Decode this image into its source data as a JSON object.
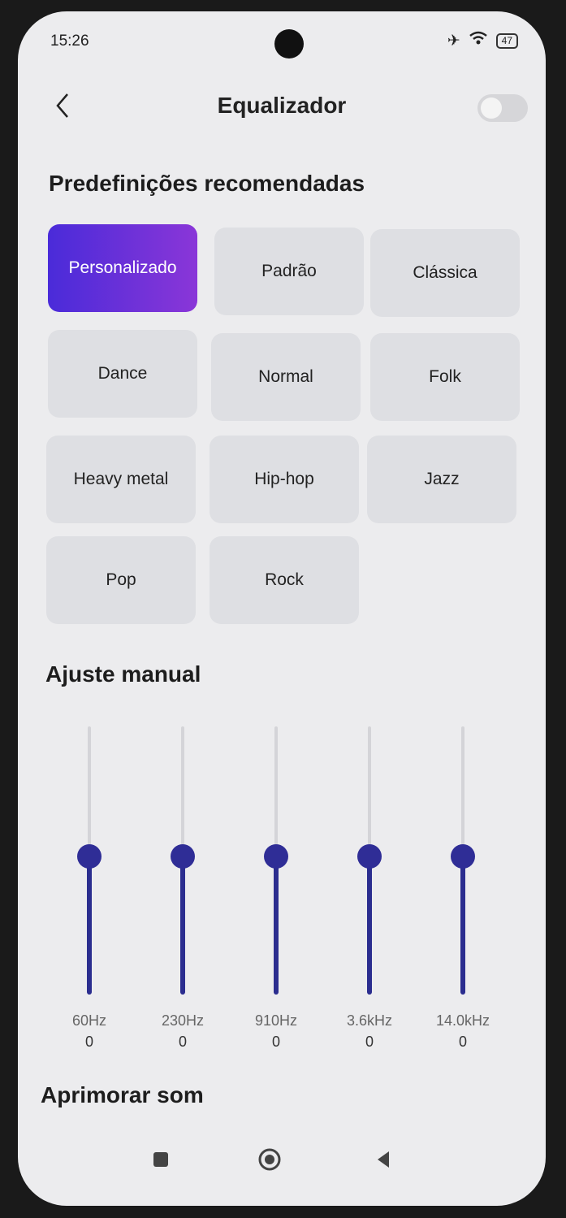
{
  "status_bar": {
    "time": "15:26",
    "battery": "47"
  },
  "header": {
    "title": "Equalizador",
    "toggle_on": false
  },
  "presets_section": {
    "title": "Predefinições recomendadas"
  },
  "presets": [
    {
      "label": "Personalizado",
      "active": true
    },
    {
      "label": "Padrão"
    },
    {
      "label": "Clássica"
    },
    {
      "label": "Dance"
    },
    {
      "label": "Normal"
    },
    {
      "label": "Folk"
    },
    {
      "label": "Heavy metal"
    },
    {
      "label": "Hip-hop"
    },
    {
      "label": "Jazz"
    },
    {
      "label": "Pop"
    },
    {
      "label": "Rock"
    }
  ],
  "manual_section": {
    "title": "Ajuste manual"
  },
  "bands": [
    {
      "freq": "60Hz",
      "value": "0"
    },
    {
      "freq": "230Hz",
      "value": "0"
    },
    {
      "freq": "910Hz",
      "value": "0"
    },
    {
      "freq": "3.6kHz",
      "value": "0"
    },
    {
      "freq": "14.0kHz",
      "value": "0"
    }
  ],
  "enhance_section": {
    "title": "Aprimorar som"
  },
  "colors": {
    "accent": "#2f2d96",
    "active_start": "#4a2bd9",
    "active_end": "#8a36d8"
  },
  "icons": [
    "back-icon",
    "recents-icon",
    "home-icon",
    "back-nav-icon",
    "airplane-icon",
    "wifi-icon",
    "battery-icon"
  ]
}
